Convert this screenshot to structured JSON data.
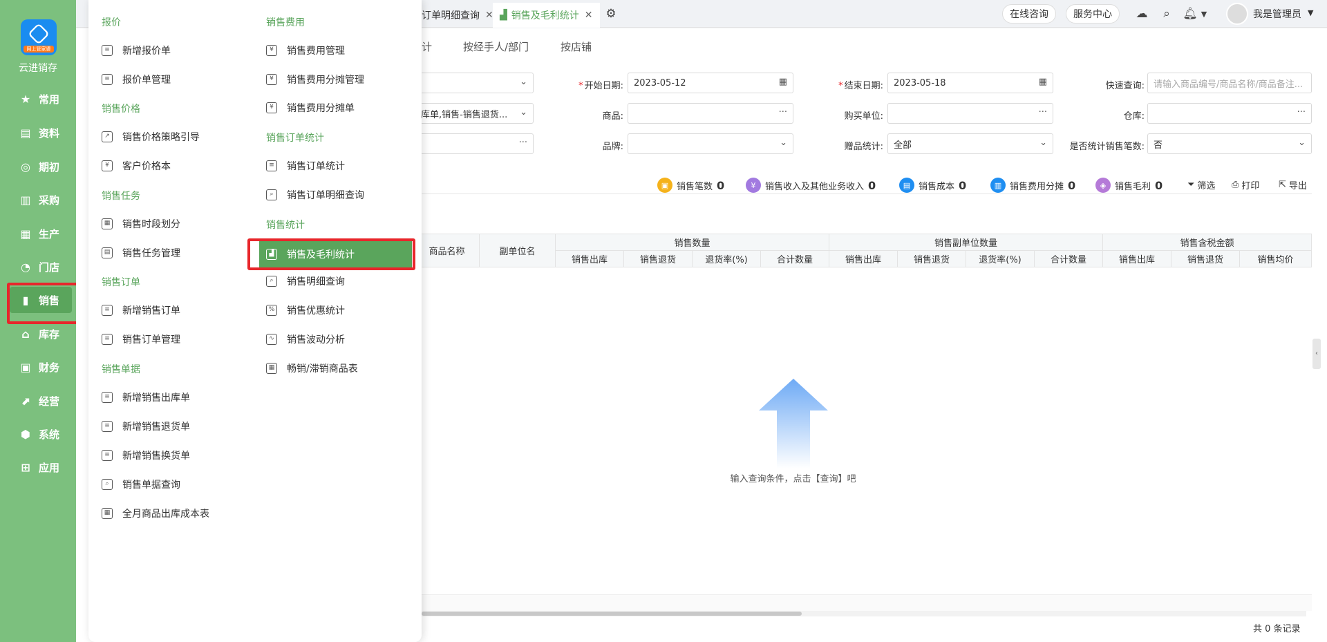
{
  "sidebar": {
    "logo_tag": "网上管家婆",
    "app_name": "云进销存",
    "items": [
      {
        "label": "常用",
        "icon": "star-icon"
      },
      {
        "label": "资料",
        "icon": "document-icon"
      },
      {
        "label": "期初",
        "icon": "target-icon"
      },
      {
        "label": "采购",
        "icon": "purchase-icon"
      },
      {
        "label": "生产",
        "icon": "factory-icon"
      },
      {
        "label": "门店",
        "icon": "store-icon"
      },
      {
        "label": "销售",
        "icon": "sales-chart-icon"
      },
      {
        "label": "库存",
        "icon": "warehouse-icon"
      },
      {
        "label": "财务",
        "icon": "finance-icon"
      },
      {
        "label": "经营",
        "icon": "trend-icon"
      },
      {
        "label": "系统",
        "icon": "gear-icon"
      },
      {
        "label": "应用",
        "icon": "plus-app-icon"
      }
    ],
    "active_index": 6
  },
  "topbar": {
    "tabs": [
      {
        "label": "订单明细查询",
        "active": false
      },
      {
        "label": "销售及毛利统计",
        "active": true
      }
    ],
    "online_consult": "在线咨询",
    "service_center": "服务中心",
    "user_name": "我是管理员"
  },
  "subtabs": [
    "计",
    "按经手人/部门",
    "按店铺"
  ],
  "filters": {
    "start_date_label": "开始日期:",
    "start_date": "2023-05-12",
    "end_date_label": "结束日期:",
    "end_date": "2023-05-18",
    "quick_search_label": "快速查询:",
    "quick_search_placeholder": "请输入商品编号/商品名称/商品备注...",
    "bill_types_value": "库单,销售-销售退货...",
    "product_label": "商品:",
    "buyer_label": "购买单位:",
    "warehouse_label": "仓库:",
    "brand_label": "品牌:",
    "gift_label": "赠品统计:",
    "gift_value": "全部",
    "count_label": "是否统计销售笔数:",
    "count_value": "否"
  },
  "summary": {
    "sales_count_label": "销售笔数",
    "sales_count": "0",
    "income_label": "销售收入及其他业务收入",
    "income": "0",
    "cost_label": "销售成本",
    "cost": "0",
    "expense_label": "销售费用分摊",
    "expense": "0",
    "profit_label": "销售毛利",
    "profit": "0",
    "filter_label": "筛选",
    "print_label": "打印",
    "export_label": "导出"
  },
  "table": {
    "col_product_name": "商品名称",
    "col_sub_unit": "副单位名",
    "group_qty": "销售数量",
    "group_sub_qty": "销售副单位数量",
    "group_tax_amount": "销售含税金额",
    "qty_cols": [
      "销售出库",
      "销售退货",
      "退货率(%)",
      "合计数量"
    ],
    "sub_cols": [
      "销售出库",
      "销售退货",
      "退货率(%)",
      "合计数量"
    ],
    "amount_cols": [
      "销售出库",
      "销售退货",
      "销售均价"
    ],
    "empty_text": "输入查询条件，点击【查询】吧",
    "record_count": "共 0 条记录"
  },
  "menu": {
    "col1": [
      {
        "cat": "报价",
        "items": [
          "新增报价单",
          "报价单管理"
        ]
      },
      {
        "cat": "销售价格",
        "items": [
          "销售价格策略引导",
          "客户价格本"
        ]
      },
      {
        "cat": "销售任务",
        "items": [
          "销售时段划分",
          "销售任务管理"
        ]
      },
      {
        "cat": "销售订单",
        "items": [
          "新增销售订单",
          "销售订单管理"
        ]
      },
      {
        "cat": "销售单据",
        "items": [
          "新增销售出库单",
          "新增销售退货单",
          "新增销售换货单",
          "销售单据查询",
          "全月商品出库成本表"
        ]
      }
    ],
    "col2": [
      {
        "cat": "销售费用",
        "items": [
          "销售费用管理",
          "销售费用分摊管理",
          "销售费用分摊单"
        ]
      },
      {
        "cat": "销售订单统计",
        "items": [
          "销售订单统计",
          "销售订单明细查询"
        ]
      },
      {
        "cat": "销售统计",
        "items": [
          "销售及毛利统计",
          "销售明细查询",
          "销售优惠统计",
          "销售波动分析",
          "畅销/滞销商品表"
        ]
      }
    ],
    "selected": "销售及毛利统计"
  },
  "colors": {
    "brand_green": "#7cc07e",
    "active_green": "#5aa55c",
    "highlight_red": "#e8262b"
  }
}
